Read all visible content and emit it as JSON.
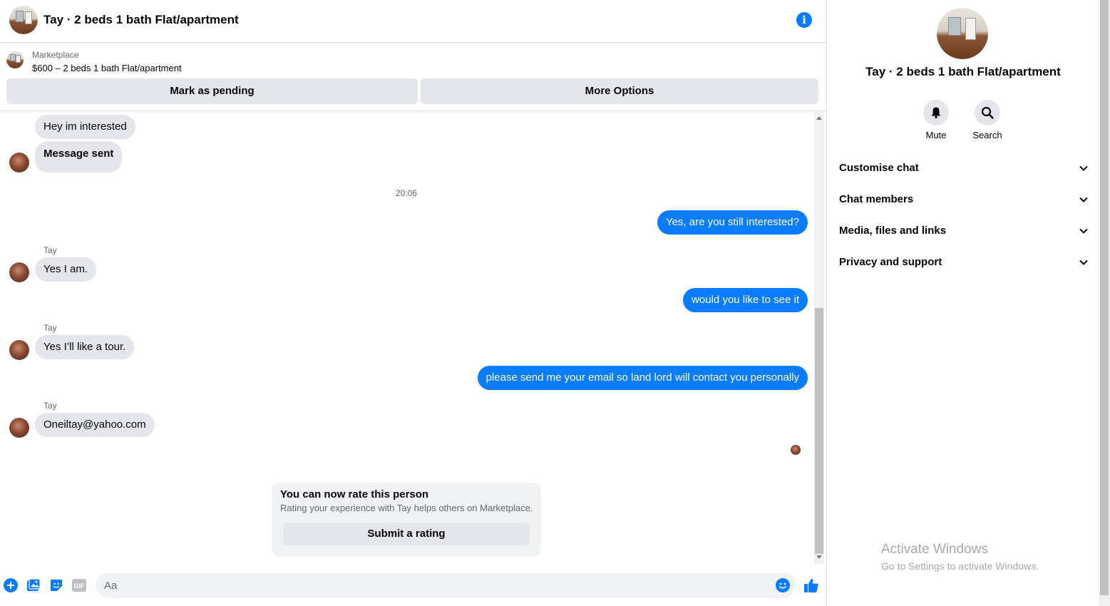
{
  "header": {
    "title": "Tay · 2 beds 1 bath Flat/apartment",
    "info_icon": "info-icon"
  },
  "marketplace": {
    "label": "Marketplace",
    "item": "$600 – 2 beds 1 bath Flat/apartment",
    "pending_button": "Mark as pending",
    "options_button": "More Options"
  },
  "messages": {
    "m1": "Hey im interested",
    "m2": "Message sent",
    "time": "20:06",
    "m3": "Yes, are you still interested?",
    "sender1": "Tay",
    "m4": "Yes I am.",
    "m5": "would you like to see it",
    "sender2": "Tay",
    "m6": "Yes I’ll like a tour.",
    "m7": "please send me your email so land lord will contact you personally",
    "sender3": "Tay",
    "m8": "Oneiltay@yahoo.com"
  },
  "rating": {
    "title": "You can now rate this person",
    "subtitle": "Rating your experience with Tay helps others on Marketplace.",
    "button": "Submit a rating"
  },
  "composer": {
    "placeholder": "Aa",
    "gif_label": "GIF"
  },
  "info_panel": {
    "title": "Tay · 2 beds 1 bath Flat/apartment",
    "mute": "Mute",
    "search": "Search",
    "sections": [
      "Customise chat",
      "Chat members",
      "Media, files and links",
      "Privacy and support"
    ]
  },
  "watermark": {
    "line1": "Activate Windows",
    "line2": "Go to Settings to activate Windows."
  },
  "colors": {
    "accent": "#0a7cff",
    "bubble_in": "#e4e6eb",
    "secondary_text": "#65676b"
  }
}
